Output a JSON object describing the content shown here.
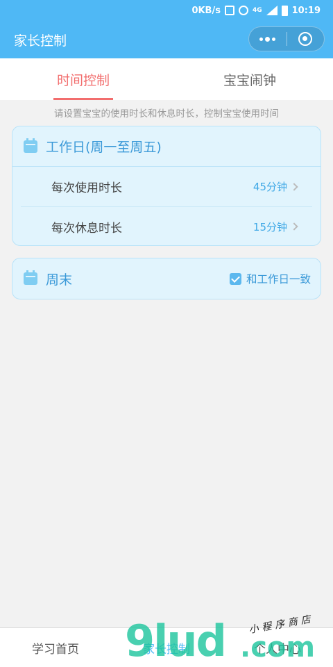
{
  "status_bar": {
    "speed": "0KB/s",
    "network": "4G",
    "time": "10:19"
  },
  "nav": {
    "title": "家长控制"
  },
  "tabs": [
    {
      "label": "时间控制",
      "active": true
    },
    {
      "label": "宝宝闹钟",
      "active": false
    }
  ],
  "hint": "请设置宝宝的使用时长和休息时长，控制宝宝使用时间",
  "weekday_card": {
    "title": "工作日(周一至周五)",
    "rows": [
      {
        "label": "每次使用时长",
        "value": "45分钟"
      },
      {
        "label": "每次休息时长",
        "value": "15分钟"
      }
    ]
  },
  "weekend_card": {
    "title": "周末",
    "checkbox_label": "和工作日一致",
    "checked": true
  },
  "tabbar": [
    {
      "label": "学习首页",
      "active": false
    },
    {
      "label": "家长控制",
      "active": true
    },
    {
      "label": "个人中心",
      "active": false
    }
  ],
  "watermark": {
    "main": "9lud",
    "domain": ".com",
    "sub": "小程序商店"
  },
  "colors": {
    "primary": "#4fb8f5",
    "accent": "#f26d6d",
    "card_bg": "#e1f4fd"
  }
}
